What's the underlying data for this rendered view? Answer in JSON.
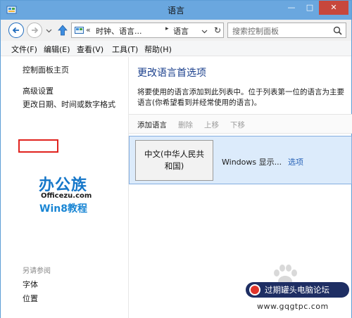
{
  "window": {
    "title": "语言",
    "minimize_glyph": "—",
    "maximize_glyph": "□",
    "close_glyph": "✕"
  },
  "nav": {
    "address": {
      "separator_glyph": "«",
      "breadcrumb": "时钟、语言...",
      "crumb_arrow": "▸",
      "current": "语言",
      "refresh_glyph": "↻"
    },
    "search_placeholder": "搜索控制面板"
  },
  "menu": {
    "items": [
      "文件(F)",
      "编辑(E)",
      "查看(V)",
      "工具(T)",
      "帮助(H)"
    ]
  },
  "left_pane": {
    "home_link": "控制面板主页",
    "advanced_settings": "高级设置",
    "date_time_link": "更改日期、时间或数字格式",
    "see_also_heading": "另请参阅",
    "see_also_links": [
      "字体",
      "位置"
    ]
  },
  "watermark": {
    "logo_main": "办公族",
    "logo_sub": "Officezu.com",
    "logo_win8": "Win8教程",
    "forum_name": "过期罐头电脑论坛",
    "site_url": "www.gqgtpc.com"
  },
  "main": {
    "title": "更改语言首选项",
    "description": "将要使用的语言添加到此列表中。位于列表第一位的语言为主要语言(你希望看到并经常使用的语言)。",
    "toolbar": {
      "add": "添加语言",
      "remove": "删除",
      "move_up": "上移",
      "move_down": "下移"
    },
    "languages": [
      {
        "name_line1": "中文(中华人民共",
        "name_line2": "和国)",
        "status": "Windows 显示...",
        "options": "选项"
      }
    ]
  },
  "colors": {
    "titlebar": "#6aa7df",
    "close_button": "#c7473c",
    "link_title": "#1a3f8c",
    "selection_bg": "#dcebfb",
    "highlight_box": "#e0231e"
  }
}
